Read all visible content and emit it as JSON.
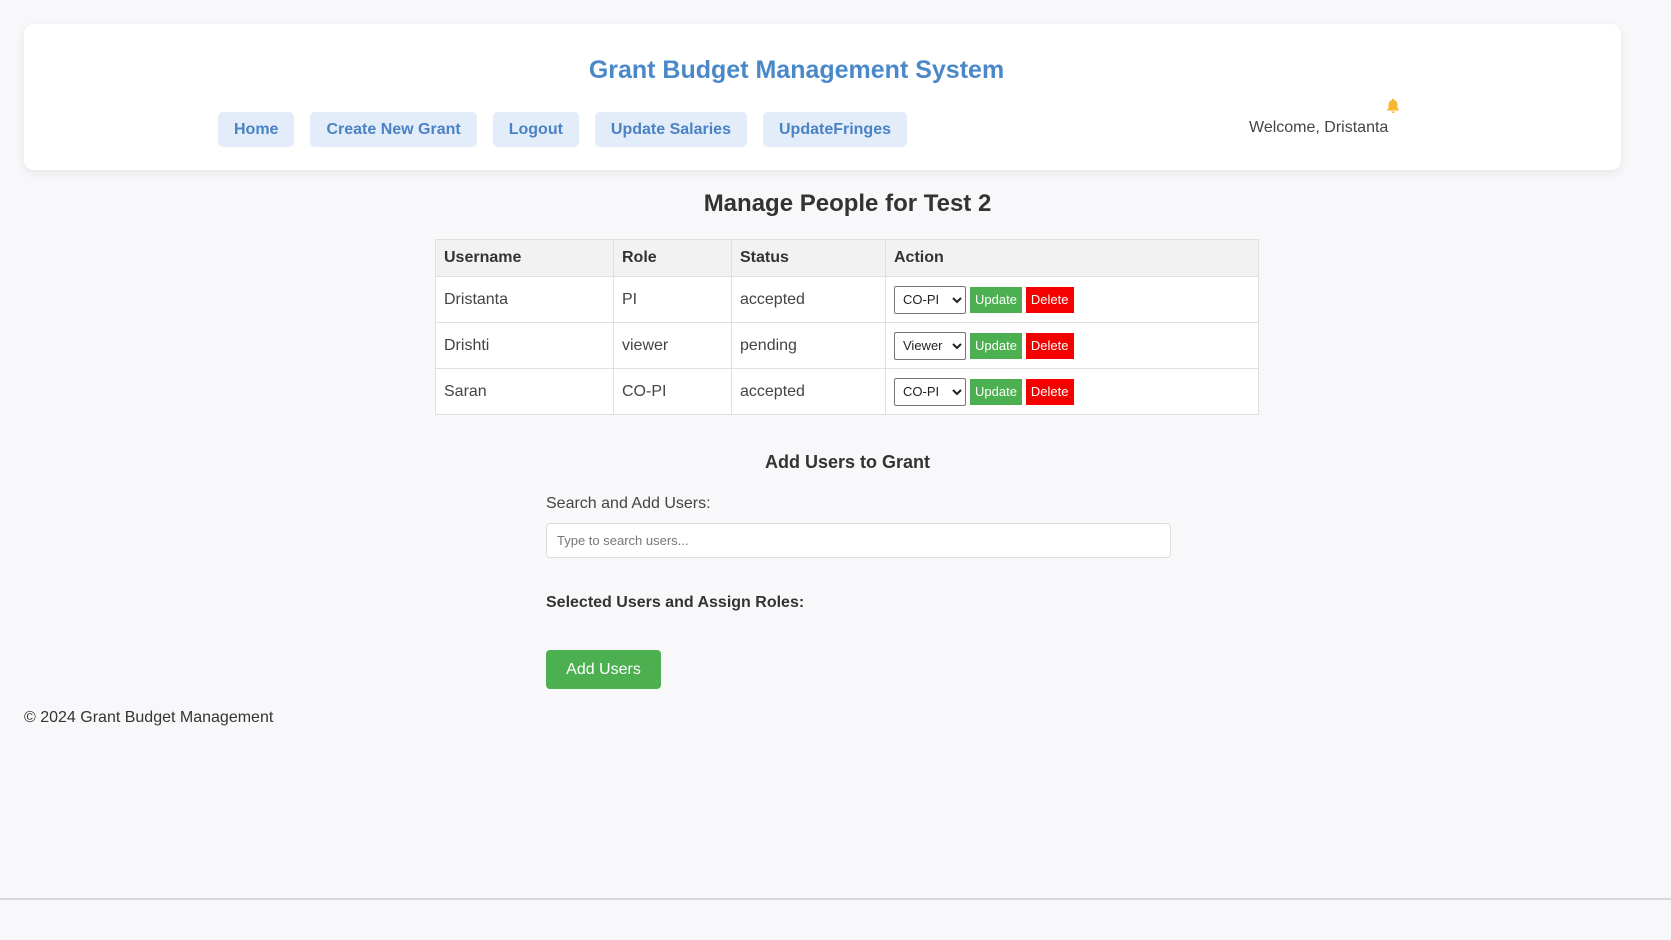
{
  "header": {
    "title": "Grant Budget Management System",
    "nav": [
      {
        "label": "Home"
      },
      {
        "label": "Create New Grant"
      },
      {
        "label": "Logout"
      },
      {
        "label": "Update Salaries"
      },
      {
        "label": "UpdateFringes"
      }
    ],
    "welcome": "Welcome, Dristanta",
    "notification_icon": "bell-icon",
    "accent_color": "#4a88c9",
    "bell_color": "#f5b82e"
  },
  "main": {
    "heading": "Manage People for Test 2",
    "table": {
      "columns": [
        "Username",
        "Role",
        "Status",
        "Action"
      ],
      "rows": [
        {
          "username": "Dristanta",
          "role": "PI",
          "status": "accepted",
          "selected_role": "CO-PI",
          "update_label": "Update",
          "delete_label": "Delete"
        },
        {
          "username": "Drishti",
          "role": "viewer",
          "status": "pending",
          "selected_role": "Viewer",
          "update_label": "Update",
          "delete_label": "Delete"
        },
        {
          "username": "Saran",
          "role": "CO-PI",
          "status": "accepted",
          "selected_role": "CO-PI",
          "update_label": "Update",
          "delete_label": "Delete"
        }
      ]
    },
    "add_users": {
      "heading": "Add Users to Grant",
      "search_label": "Search and Add Users:",
      "search_placeholder": "Type to search users...",
      "search_value": "",
      "selected_label": "Selected Users and Assign Roles:",
      "add_button": "Add Users"
    }
  },
  "footer": {
    "text": "© 2024 Grant Budget Management"
  },
  "colors": {
    "update_button": "#4caf50",
    "delete_button": "#f40000",
    "nav_button_bg": "#e3edf9"
  }
}
